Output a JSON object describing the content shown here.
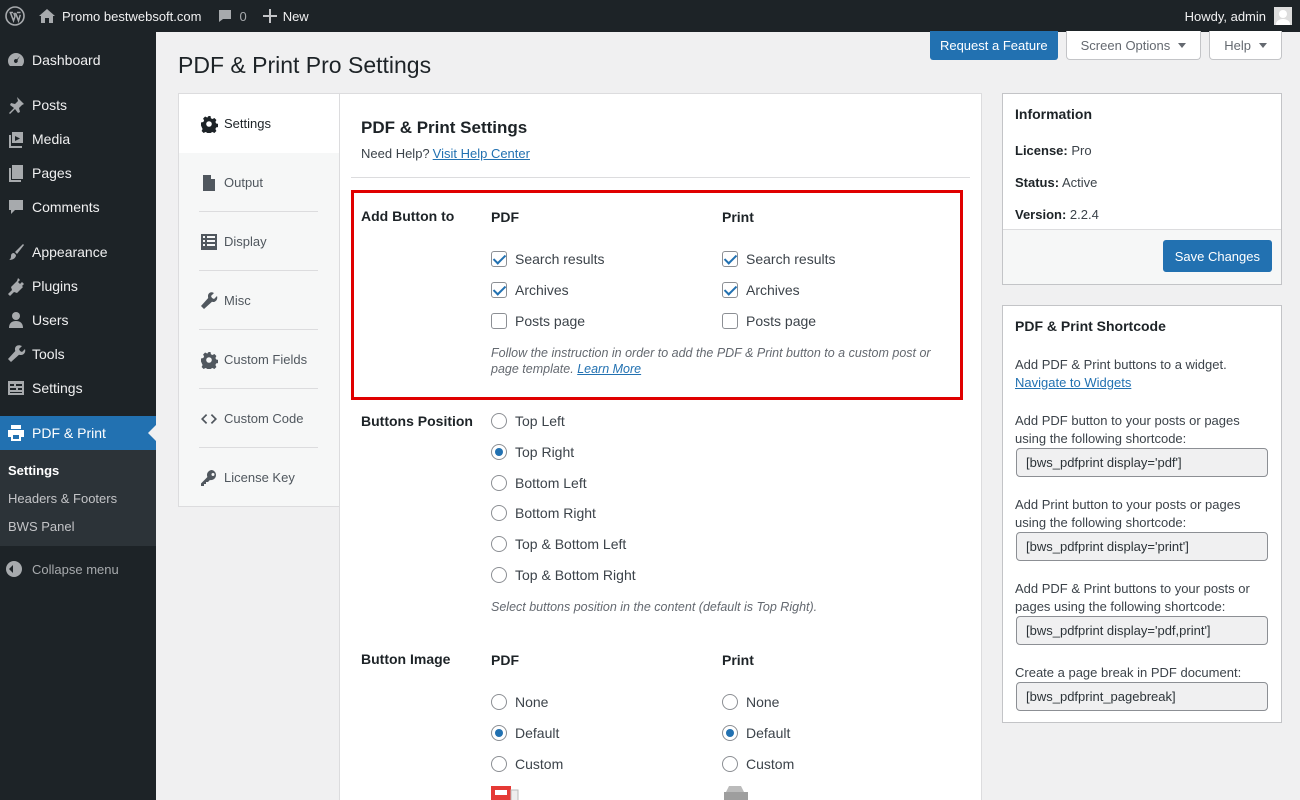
{
  "admin_bar": {
    "site_name": "Promo bestwebsoft.com",
    "comments_count": "0",
    "new_label": "New",
    "greeting": "Howdy, admin"
  },
  "sidebar": {
    "items": [
      {
        "label": "Dashboard",
        "icon": "dashboard-icon"
      },
      {
        "label": "Posts",
        "icon": "pin-icon"
      },
      {
        "label": "Media",
        "icon": "media-icon"
      },
      {
        "label": "Pages",
        "icon": "pages-icon"
      },
      {
        "label": "Comments",
        "icon": "comment-icon"
      },
      {
        "label": "Appearance",
        "icon": "brush-icon"
      },
      {
        "label": "Plugins",
        "icon": "plugin-icon"
      },
      {
        "label": "Users",
        "icon": "user-icon"
      },
      {
        "label": "Tools",
        "icon": "wrench-icon"
      },
      {
        "label": "Settings",
        "icon": "settings-icon"
      },
      {
        "label": "PDF & Print",
        "icon": "printer-icon"
      }
    ],
    "submenu": [
      "Settings",
      "Headers & Footers",
      "BWS Panel"
    ],
    "collapse_label": "Collapse menu"
  },
  "top_buttons": {
    "request_feature": "Request a Feature",
    "screen_options": "Screen Options",
    "help": "Help"
  },
  "page_title": "PDF & Print Pro Settings",
  "tabs": [
    {
      "label": "Settings",
      "icon": "gear-icon"
    },
    {
      "label": "Output",
      "icon": "document-icon"
    },
    {
      "label": "Display",
      "icon": "list-icon"
    },
    {
      "label": "Misc",
      "icon": "wrench-icon"
    },
    {
      "label": "Custom Fields",
      "icon": "gear-icon"
    },
    {
      "label": "Custom Code",
      "icon": "code-icon"
    },
    {
      "label": "License Key",
      "icon": "key-icon"
    }
  ],
  "settings": {
    "heading": "PDF & Print Settings",
    "help_prefix": "Need Help?",
    "help_link": "Visit Help Center",
    "add_button": {
      "label": "Add Button to",
      "pdf_head": "PDF",
      "print_head": "Print",
      "pdf_options": [
        {
          "label": "Search results",
          "checked": true
        },
        {
          "label": "Archives",
          "checked": true
        },
        {
          "label": "Posts page",
          "checked": false
        }
      ],
      "print_options": [
        {
          "label": "Search results",
          "checked": true
        },
        {
          "label": "Archives",
          "checked": true
        },
        {
          "label": "Posts page",
          "checked": false
        }
      ],
      "note": "Follow the instruction in order to add the PDF & Print button to a custom post or page template.",
      "note_link": "Learn More"
    },
    "position": {
      "label": "Buttons Position",
      "options": [
        {
          "label": "Top Left",
          "selected": false
        },
        {
          "label": "Top Right",
          "selected": true
        },
        {
          "label": "Bottom Left",
          "selected": false
        },
        {
          "label": "Bottom Right",
          "selected": false
        },
        {
          "label": "Top & Bottom Left",
          "selected": false
        },
        {
          "label": "Top & Bottom Right",
          "selected": false
        }
      ],
      "note": "Select buttons position in the content (default is Top Right)."
    },
    "image": {
      "label": "Button Image",
      "pdf_head": "PDF",
      "print_head": "Print",
      "pdf_options": [
        {
          "label": "None",
          "selected": false
        },
        {
          "label": "Default",
          "selected": true
        },
        {
          "label": "Custom",
          "selected": false
        }
      ],
      "print_options": [
        {
          "label": "None",
          "selected": false
        },
        {
          "label": "Default",
          "selected": true
        },
        {
          "label": "Custom",
          "selected": false
        }
      ]
    }
  },
  "info_box": {
    "title": "Information",
    "license_label": "License:",
    "license_value": "Pro",
    "status_label": "Status:",
    "status_value": "Active",
    "version_label": "Version:",
    "version_value": "2.2.4",
    "save_label": "Save Changes"
  },
  "shortcode_box": {
    "title": "PDF & Print Shortcode",
    "widget_text": "Add PDF & Print buttons to a widget.",
    "widget_link": "Navigate to Widgets",
    "pdf_text": "Add PDF button to your posts or pages using the following shortcode:",
    "pdf_code": "[bws_pdfprint display='pdf']",
    "print_text": "Add Print button to your posts or pages using the following shortcode:",
    "print_code": "[bws_pdfprint display='print']",
    "both_text": "Add PDF & Print buttons to your posts or pages using the following shortcode:",
    "both_code": "[bws_pdfprint display='pdf,print']",
    "break_text": "Create a page break in PDF document:",
    "break_code": "[bws_pdfprint_pagebreak]"
  }
}
